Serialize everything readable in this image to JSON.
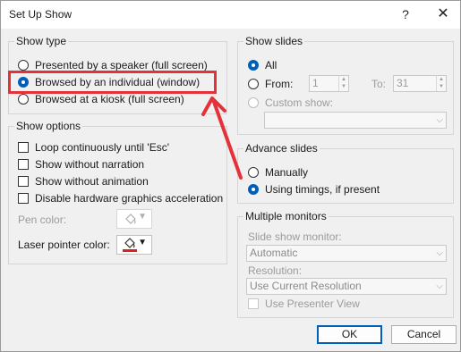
{
  "window": {
    "title": "Set Up Show",
    "help_glyph": "?",
    "close_glyph": "✕"
  },
  "show_type": {
    "label": "Show type",
    "options": [
      {
        "label": "Presented by a speaker (full screen)",
        "selected": false
      },
      {
        "label": "Browsed by an individual (window)",
        "selected": true
      },
      {
        "label": "Browsed at a kiosk (full screen)",
        "selected": false
      }
    ]
  },
  "show_options": {
    "label": "Show options",
    "checkboxes": [
      {
        "label": "Loop continuously until 'Esc'",
        "checked": false
      },
      {
        "label": "Show without narration",
        "checked": false
      },
      {
        "label": "Show without animation",
        "checked": false
      },
      {
        "label": "Disable hardware graphics acceleration",
        "checked": false
      }
    ],
    "pen_color_label": "Pen color:",
    "laser_color_label": "Laser pointer color:",
    "laser_color": "#e0201f"
  },
  "show_slides": {
    "label": "Show slides",
    "all_label": "All",
    "from_label": "From:",
    "from_value": "1",
    "to_label": "To:",
    "to_value": "31",
    "custom_label": "Custom show:"
  },
  "advance_slides": {
    "label": "Advance slides",
    "manually_label": "Manually",
    "timings_label": "Using timings, if present"
  },
  "monitors": {
    "label": "Multiple monitors",
    "monitor_label": "Slide show monitor:",
    "monitor_value": "Automatic",
    "resolution_label": "Resolution:",
    "resolution_value": "Use Current Resolution",
    "presenter_view_label": "Use Presenter View"
  },
  "buttons": {
    "ok": "OK",
    "cancel": "Cancel"
  },
  "colors": {
    "accent": "#005fb8",
    "annotation": "#e53238"
  }
}
